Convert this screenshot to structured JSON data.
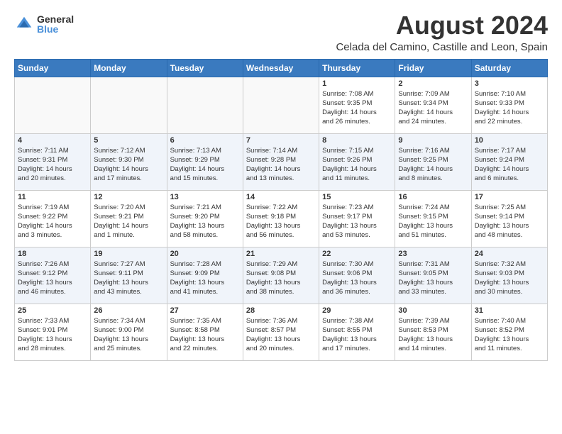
{
  "logo": {
    "general": "General",
    "blue": "Blue"
  },
  "title": "August 2024",
  "location": "Celada del Camino, Castille and Leon, Spain",
  "days_of_week": [
    "Sunday",
    "Monday",
    "Tuesday",
    "Wednesday",
    "Thursday",
    "Friday",
    "Saturday"
  ],
  "weeks": [
    [
      {
        "day": "",
        "info": ""
      },
      {
        "day": "",
        "info": ""
      },
      {
        "day": "",
        "info": ""
      },
      {
        "day": "",
        "info": ""
      },
      {
        "day": "1",
        "info": "Sunrise: 7:08 AM\nSunset: 9:35 PM\nDaylight: 14 hours\nand 26 minutes."
      },
      {
        "day": "2",
        "info": "Sunrise: 7:09 AM\nSunset: 9:34 PM\nDaylight: 14 hours\nand 24 minutes."
      },
      {
        "day": "3",
        "info": "Sunrise: 7:10 AM\nSunset: 9:33 PM\nDaylight: 14 hours\nand 22 minutes."
      }
    ],
    [
      {
        "day": "4",
        "info": "Sunrise: 7:11 AM\nSunset: 9:31 PM\nDaylight: 14 hours\nand 20 minutes."
      },
      {
        "day": "5",
        "info": "Sunrise: 7:12 AM\nSunset: 9:30 PM\nDaylight: 14 hours\nand 17 minutes."
      },
      {
        "day": "6",
        "info": "Sunrise: 7:13 AM\nSunset: 9:29 PM\nDaylight: 14 hours\nand 15 minutes."
      },
      {
        "day": "7",
        "info": "Sunrise: 7:14 AM\nSunset: 9:28 PM\nDaylight: 14 hours\nand 13 minutes."
      },
      {
        "day": "8",
        "info": "Sunrise: 7:15 AM\nSunset: 9:26 PM\nDaylight: 14 hours\nand 11 minutes."
      },
      {
        "day": "9",
        "info": "Sunrise: 7:16 AM\nSunset: 9:25 PM\nDaylight: 14 hours\nand 8 minutes."
      },
      {
        "day": "10",
        "info": "Sunrise: 7:17 AM\nSunset: 9:24 PM\nDaylight: 14 hours\nand 6 minutes."
      }
    ],
    [
      {
        "day": "11",
        "info": "Sunrise: 7:19 AM\nSunset: 9:22 PM\nDaylight: 14 hours\nand 3 minutes."
      },
      {
        "day": "12",
        "info": "Sunrise: 7:20 AM\nSunset: 9:21 PM\nDaylight: 14 hours\nand 1 minute."
      },
      {
        "day": "13",
        "info": "Sunrise: 7:21 AM\nSunset: 9:20 PM\nDaylight: 13 hours\nand 58 minutes."
      },
      {
        "day": "14",
        "info": "Sunrise: 7:22 AM\nSunset: 9:18 PM\nDaylight: 13 hours\nand 56 minutes."
      },
      {
        "day": "15",
        "info": "Sunrise: 7:23 AM\nSunset: 9:17 PM\nDaylight: 13 hours\nand 53 minutes."
      },
      {
        "day": "16",
        "info": "Sunrise: 7:24 AM\nSunset: 9:15 PM\nDaylight: 13 hours\nand 51 minutes."
      },
      {
        "day": "17",
        "info": "Sunrise: 7:25 AM\nSunset: 9:14 PM\nDaylight: 13 hours\nand 48 minutes."
      }
    ],
    [
      {
        "day": "18",
        "info": "Sunrise: 7:26 AM\nSunset: 9:12 PM\nDaylight: 13 hours\nand 46 minutes."
      },
      {
        "day": "19",
        "info": "Sunrise: 7:27 AM\nSunset: 9:11 PM\nDaylight: 13 hours\nand 43 minutes."
      },
      {
        "day": "20",
        "info": "Sunrise: 7:28 AM\nSunset: 9:09 PM\nDaylight: 13 hours\nand 41 minutes."
      },
      {
        "day": "21",
        "info": "Sunrise: 7:29 AM\nSunset: 9:08 PM\nDaylight: 13 hours\nand 38 minutes."
      },
      {
        "day": "22",
        "info": "Sunrise: 7:30 AM\nSunset: 9:06 PM\nDaylight: 13 hours\nand 36 minutes."
      },
      {
        "day": "23",
        "info": "Sunrise: 7:31 AM\nSunset: 9:05 PM\nDaylight: 13 hours\nand 33 minutes."
      },
      {
        "day": "24",
        "info": "Sunrise: 7:32 AM\nSunset: 9:03 PM\nDaylight: 13 hours\nand 30 minutes."
      }
    ],
    [
      {
        "day": "25",
        "info": "Sunrise: 7:33 AM\nSunset: 9:01 PM\nDaylight: 13 hours\nand 28 minutes."
      },
      {
        "day": "26",
        "info": "Sunrise: 7:34 AM\nSunset: 9:00 PM\nDaylight: 13 hours\nand 25 minutes."
      },
      {
        "day": "27",
        "info": "Sunrise: 7:35 AM\nSunset: 8:58 PM\nDaylight: 13 hours\nand 22 minutes."
      },
      {
        "day": "28",
        "info": "Sunrise: 7:36 AM\nSunset: 8:57 PM\nDaylight: 13 hours\nand 20 minutes."
      },
      {
        "day": "29",
        "info": "Sunrise: 7:38 AM\nSunset: 8:55 PM\nDaylight: 13 hours\nand 17 minutes."
      },
      {
        "day": "30",
        "info": "Sunrise: 7:39 AM\nSunset: 8:53 PM\nDaylight: 13 hours\nand 14 minutes."
      },
      {
        "day": "31",
        "info": "Sunrise: 7:40 AM\nSunset: 8:52 PM\nDaylight: 13 hours\nand 11 minutes."
      }
    ]
  ]
}
